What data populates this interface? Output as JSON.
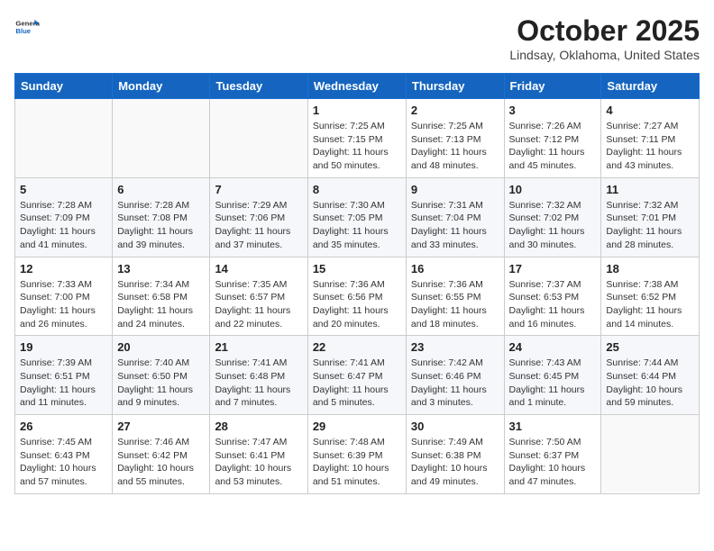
{
  "header": {
    "logo_general": "General",
    "logo_blue": "Blue",
    "title": "October 2025",
    "location": "Lindsay, Oklahoma, United States"
  },
  "days_of_week": [
    "Sunday",
    "Monday",
    "Tuesday",
    "Wednesday",
    "Thursday",
    "Friday",
    "Saturday"
  ],
  "weeks": [
    [
      {
        "day": "",
        "info": ""
      },
      {
        "day": "",
        "info": ""
      },
      {
        "day": "",
        "info": ""
      },
      {
        "day": "1",
        "info": "Sunrise: 7:25 AM\nSunset: 7:15 PM\nDaylight: 11 hours and 50 minutes."
      },
      {
        "day": "2",
        "info": "Sunrise: 7:25 AM\nSunset: 7:13 PM\nDaylight: 11 hours and 48 minutes."
      },
      {
        "day": "3",
        "info": "Sunrise: 7:26 AM\nSunset: 7:12 PM\nDaylight: 11 hours and 45 minutes."
      },
      {
        "day": "4",
        "info": "Sunrise: 7:27 AM\nSunset: 7:11 PM\nDaylight: 11 hours and 43 minutes."
      }
    ],
    [
      {
        "day": "5",
        "info": "Sunrise: 7:28 AM\nSunset: 7:09 PM\nDaylight: 11 hours and 41 minutes."
      },
      {
        "day": "6",
        "info": "Sunrise: 7:28 AM\nSunset: 7:08 PM\nDaylight: 11 hours and 39 minutes."
      },
      {
        "day": "7",
        "info": "Sunrise: 7:29 AM\nSunset: 7:06 PM\nDaylight: 11 hours and 37 minutes."
      },
      {
        "day": "8",
        "info": "Sunrise: 7:30 AM\nSunset: 7:05 PM\nDaylight: 11 hours and 35 minutes."
      },
      {
        "day": "9",
        "info": "Sunrise: 7:31 AM\nSunset: 7:04 PM\nDaylight: 11 hours and 33 minutes."
      },
      {
        "day": "10",
        "info": "Sunrise: 7:32 AM\nSunset: 7:02 PM\nDaylight: 11 hours and 30 minutes."
      },
      {
        "day": "11",
        "info": "Sunrise: 7:32 AM\nSunset: 7:01 PM\nDaylight: 11 hours and 28 minutes."
      }
    ],
    [
      {
        "day": "12",
        "info": "Sunrise: 7:33 AM\nSunset: 7:00 PM\nDaylight: 11 hours and 26 minutes."
      },
      {
        "day": "13",
        "info": "Sunrise: 7:34 AM\nSunset: 6:58 PM\nDaylight: 11 hours and 24 minutes."
      },
      {
        "day": "14",
        "info": "Sunrise: 7:35 AM\nSunset: 6:57 PM\nDaylight: 11 hours and 22 minutes."
      },
      {
        "day": "15",
        "info": "Sunrise: 7:36 AM\nSunset: 6:56 PM\nDaylight: 11 hours and 20 minutes."
      },
      {
        "day": "16",
        "info": "Sunrise: 7:36 AM\nSunset: 6:55 PM\nDaylight: 11 hours and 18 minutes."
      },
      {
        "day": "17",
        "info": "Sunrise: 7:37 AM\nSunset: 6:53 PM\nDaylight: 11 hours and 16 minutes."
      },
      {
        "day": "18",
        "info": "Sunrise: 7:38 AM\nSunset: 6:52 PM\nDaylight: 11 hours and 14 minutes."
      }
    ],
    [
      {
        "day": "19",
        "info": "Sunrise: 7:39 AM\nSunset: 6:51 PM\nDaylight: 11 hours and 11 minutes."
      },
      {
        "day": "20",
        "info": "Sunrise: 7:40 AM\nSunset: 6:50 PM\nDaylight: 11 hours and 9 minutes."
      },
      {
        "day": "21",
        "info": "Sunrise: 7:41 AM\nSunset: 6:48 PM\nDaylight: 11 hours and 7 minutes."
      },
      {
        "day": "22",
        "info": "Sunrise: 7:41 AM\nSunset: 6:47 PM\nDaylight: 11 hours and 5 minutes."
      },
      {
        "day": "23",
        "info": "Sunrise: 7:42 AM\nSunset: 6:46 PM\nDaylight: 11 hours and 3 minutes."
      },
      {
        "day": "24",
        "info": "Sunrise: 7:43 AM\nSunset: 6:45 PM\nDaylight: 11 hours and 1 minute."
      },
      {
        "day": "25",
        "info": "Sunrise: 7:44 AM\nSunset: 6:44 PM\nDaylight: 10 hours and 59 minutes."
      }
    ],
    [
      {
        "day": "26",
        "info": "Sunrise: 7:45 AM\nSunset: 6:43 PM\nDaylight: 10 hours and 57 minutes."
      },
      {
        "day": "27",
        "info": "Sunrise: 7:46 AM\nSunset: 6:42 PM\nDaylight: 10 hours and 55 minutes."
      },
      {
        "day": "28",
        "info": "Sunrise: 7:47 AM\nSunset: 6:41 PM\nDaylight: 10 hours and 53 minutes."
      },
      {
        "day": "29",
        "info": "Sunrise: 7:48 AM\nSunset: 6:39 PM\nDaylight: 10 hours and 51 minutes."
      },
      {
        "day": "30",
        "info": "Sunrise: 7:49 AM\nSunset: 6:38 PM\nDaylight: 10 hours and 49 minutes."
      },
      {
        "day": "31",
        "info": "Sunrise: 7:50 AM\nSunset: 6:37 PM\nDaylight: 10 hours and 47 minutes."
      },
      {
        "day": "",
        "info": ""
      }
    ]
  ]
}
